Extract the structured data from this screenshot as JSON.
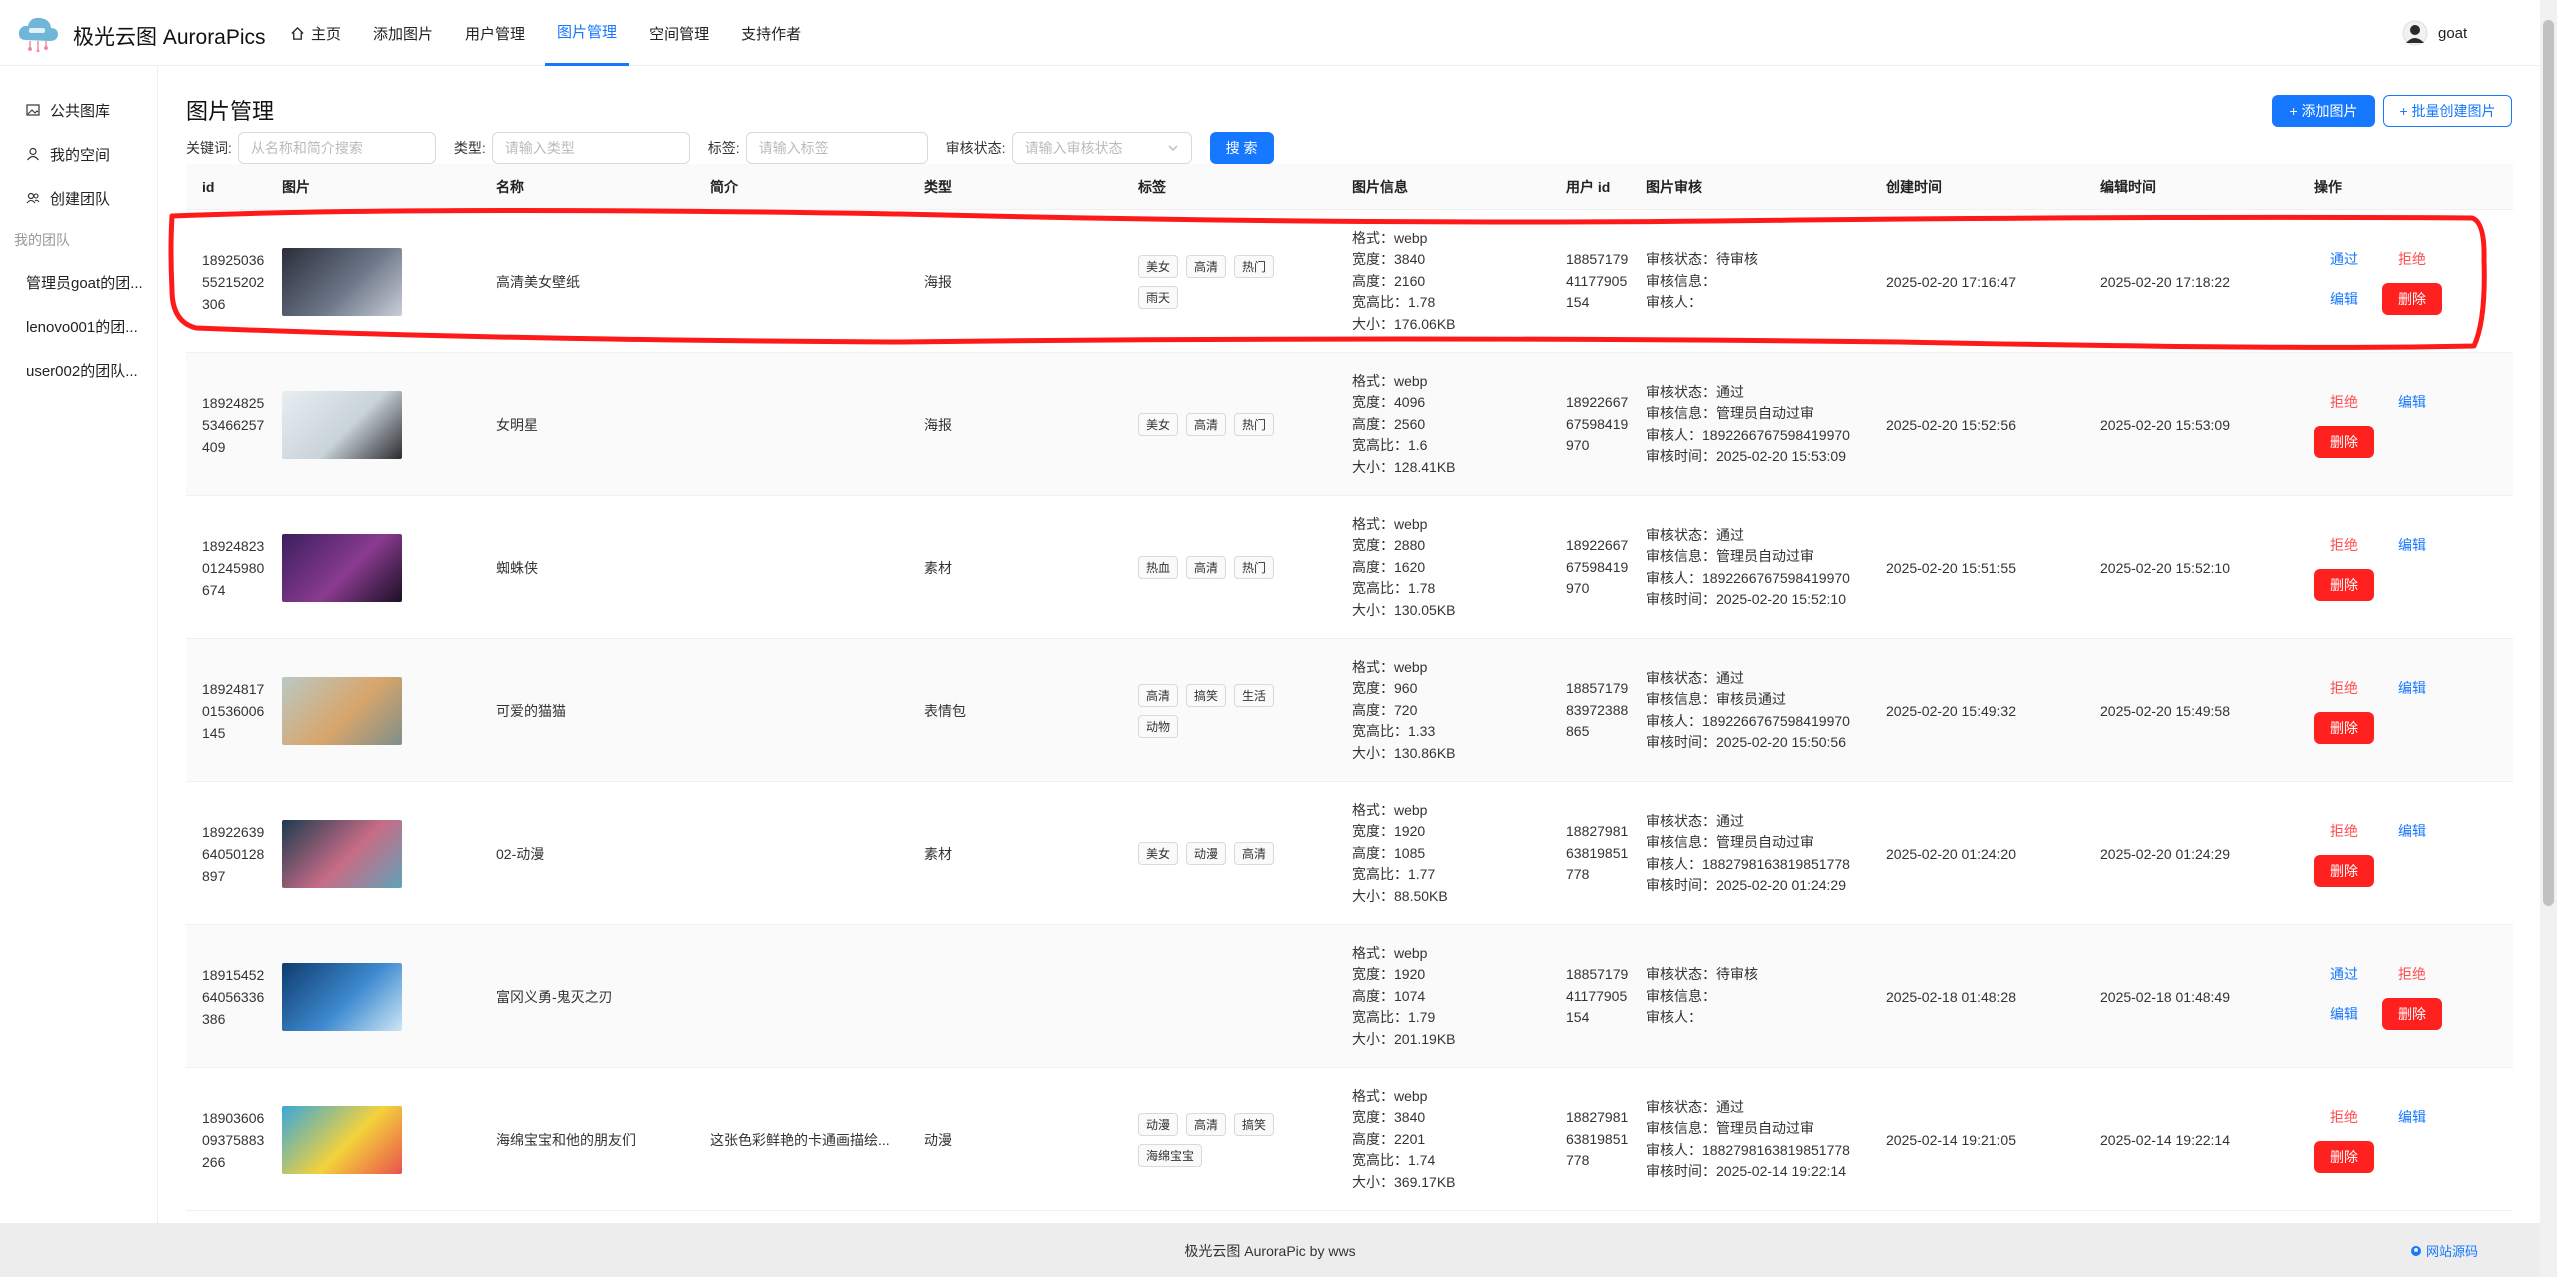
{
  "header": {
    "app_title": "极光云图 AuroraPics",
    "nav": [
      {
        "label": "主页",
        "icon": "home-icon"
      },
      {
        "label": "添加图片"
      },
      {
        "label": "用户管理"
      },
      {
        "label": "图片管理",
        "active": true
      },
      {
        "label": "空间管理"
      },
      {
        "label": "支持作者"
      }
    ],
    "username": "goat"
  },
  "sidebar": {
    "items": [
      {
        "label": "公共图库",
        "icon": "picture-icon"
      },
      {
        "label": "我的空间",
        "icon": "user-icon"
      },
      {
        "label": "创建团队",
        "icon": "team-icon"
      }
    ],
    "group_label": "我的团队",
    "teams": [
      "管理员goat的团...",
      "lenovo001的团...",
      "user002的团队..."
    ]
  },
  "page": {
    "title": "图片管理",
    "add_button": "+ 添加图片",
    "batch_button": "+ 批量创建图片"
  },
  "filters": {
    "keyword_label": "关键词:",
    "keyword_placeholder": "从名称和简介搜索",
    "type_label": "类型:",
    "type_placeholder": "请输入类型",
    "tag_label": "标签:",
    "tag_placeholder": "请输入标签",
    "review_label": "审核状态:",
    "review_placeholder": "请输入审核状态",
    "search_button": "搜 索"
  },
  "table": {
    "columns": [
      "id",
      "图片",
      "名称",
      "简介",
      "类型",
      "标签",
      "图片信息",
      "用户 id",
      "图片审核",
      "创建时间",
      "编辑时间",
      "操作"
    ],
    "actions": {
      "approve": "通过",
      "reject": "拒绝",
      "edit": "编辑",
      "delete": "删除"
    },
    "rows": [
      {
        "id": "1892503655215202306",
        "name": "高清美女壁纸",
        "intro": "",
        "type": "海报",
        "tags": [
          "美女",
          "高清",
          "热门",
          "雨天"
        ],
        "info": [
          "格式：webp",
          "宽度：3840",
          "高度：2160",
          "宽高比：1.78",
          "大小：176.06KB"
        ],
        "user_id": "1885717941177905154",
        "review": [
          "审核状态：待审核",
          "审核信息：",
          "审核人："
        ],
        "created": "2025-02-20 17:16:47",
        "edited": "2025-02-20 17:18:22",
        "pending": true,
        "thumb_colors": [
          "#2a2e3a",
          "#6b7586",
          "#c9ced8"
        ]
      },
      {
        "id": "1892482553466257409",
        "name": "女明星",
        "intro": "",
        "type": "海报",
        "tags": [
          "美女",
          "高清",
          "热门"
        ],
        "info": [
          "格式：webp",
          "宽度：4096",
          "高度：2560",
          "宽高比：1.6",
          "大小：128.41KB"
        ],
        "user_id": "1892266767598419970",
        "review": [
          "审核状态：通过",
          "审核信息：管理员自动过审",
          "审核人：1892266767598419970",
          "审核时间：2025-02-20 15:53:09"
        ],
        "created": "2025-02-20 15:52:56",
        "edited": "2025-02-20 15:53:09",
        "pending": false,
        "thumb_colors": [
          "#e8eef2",
          "#c9d3da",
          "#2b2b30"
        ]
      },
      {
        "id": "1892482301245980674",
        "name": "蜘蛛侠",
        "intro": "",
        "type": "素材",
        "tags": [
          "热血",
          "高清",
          "热门"
        ],
        "info": [
          "格式：webp",
          "宽度：2880",
          "高度：1620",
          "宽高比：1.78",
          "大小：130.05KB"
        ],
        "user_id": "1892266767598419970",
        "review": [
          "审核状态：通过",
          "审核信息：管理员自动过审",
          "审核人：1892266767598419970",
          "审核时间：2025-02-20 15:52:10"
        ],
        "created": "2025-02-20 15:51:55",
        "edited": "2025-02-20 15:52:10",
        "pending": false,
        "thumb_colors": [
          "#3a1f5e",
          "#8a3b8f",
          "#1a1024"
        ]
      },
      {
        "id": "1892481701536006145",
        "name": "可爱的猫猫",
        "intro": "",
        "type": "表情包",
        "tags": [
          "高清",
          "搞笑",
          "生活",
          "动物"
        ],
        "info": [
          "格式：webp",
          "宽度：960",
          "高度：720",
          "宽高比：1.33",
          "大小：130.86KB"
        ],
        "user_id": "1885717983972388865",
        "review": [
          "审核状态：通过",
          "审核信息：审核员通过",
          "审核人：1892266767598419970",
          "审核时间：2025-02-20 15:50:56"
        ],
        "created": "2025-02-20 15:49:32",
        "edited": "2025-02-20 15:49:58",
        "pending": false,
        "thumb_colors": [
          "#b9c9c4",
          "#d8a56b",
          "#7e8f8a"
        ]
      },
      {
        "id": "1892263964050128897",
        "name": "02-动漫",
        "intro": "",
        "type": "素材",
        "tags": [
          "美女",
          "动漫",
          "高清"
        ],
        "info": [
          "格式：webp",
          "宽度：1920",
          "高度：1085",
          "宽高比：1.77",
          "大小：88.50KB"
        ],
        "user_id": "1882798163819851778",
        "review": [
          "审核状态：通过",
          "审核信息：管理员自动过审",
          "审核人：1882798163819851778",
          "审核时间：2025-02-20 01:24:29"
        ],
        "created": "2025-02-20 01:24:20",
        "edited": "2025-02-20 01:24:29",
        "pending": false,
        "thumb_colors": [
          "#1d3b4f",
          "#c86c86",
          "#5fa3b8"
        ]
      },
      {
        "id": "1891545264056336386",
        "name": "富冈义勇-鬼灭之刃",
        "intro": "",
        "type": "",
        "tags": [],
        "info": [
          "格式：webp",
          "宽度：1920",
          "高度：1074",
          "宽高比：1.79",
          "大小：201.19KB"
        ],
        "user_id": "1885717941177905154",
        "review": [
          "审核状态：待审核",
          "审核信息：",
          "审核人："
        ],
        "created": "2025-02-18 01:48:28",
        "edited": "2025-02-18 01:48:49",
        "pending": true,
        "thumb_colors": [
          "#0f3c6e",
          "#3d8ad0",
          "#cfe6f5"
        ]
      },
      {
        "id": "1890360609375883266",
        "name": "海绵宝宝和他的朋友们",
        "intro": "这张色彩鲜艳的卡通画描绘...",
        "type": "动漫",
        "tags": [
          "动漫",
          "高清",
          "搞笑",
          "海绵宝宝"
        ],
        "info": [
          "格式：webp",
          "宽度：3840",
          "高度：2201",
          "宽高比：1.74",
          "大小：369.17KB"
        ],
        "user_id": "1882798163819851778",
        "review": [
          "审核状态：通过",
          "审核信息：管理员自动过审",
          "审核人：1882798163819851778",
          "审核时间：2025-02-14 19:22:14"
        ],
        "created": "2025-02-14 19:21:05",
        "edited": "2025-02-14 19:22:14",
        "pending": false,
        "thumb_colors": [
          "#3aa7d9",
          "#f4d23c",
          "#e8534a"
        ]
      }
    ]
  },
  "footer": {
    "text": "极光云图 AuroraPic by wws",
    "link": "网站源码"
  },
  "colors": {
    "accent": "#1677ff",
    "danger": "#ff2020",
    "annotation": "#ff1a1a"
  }
}
